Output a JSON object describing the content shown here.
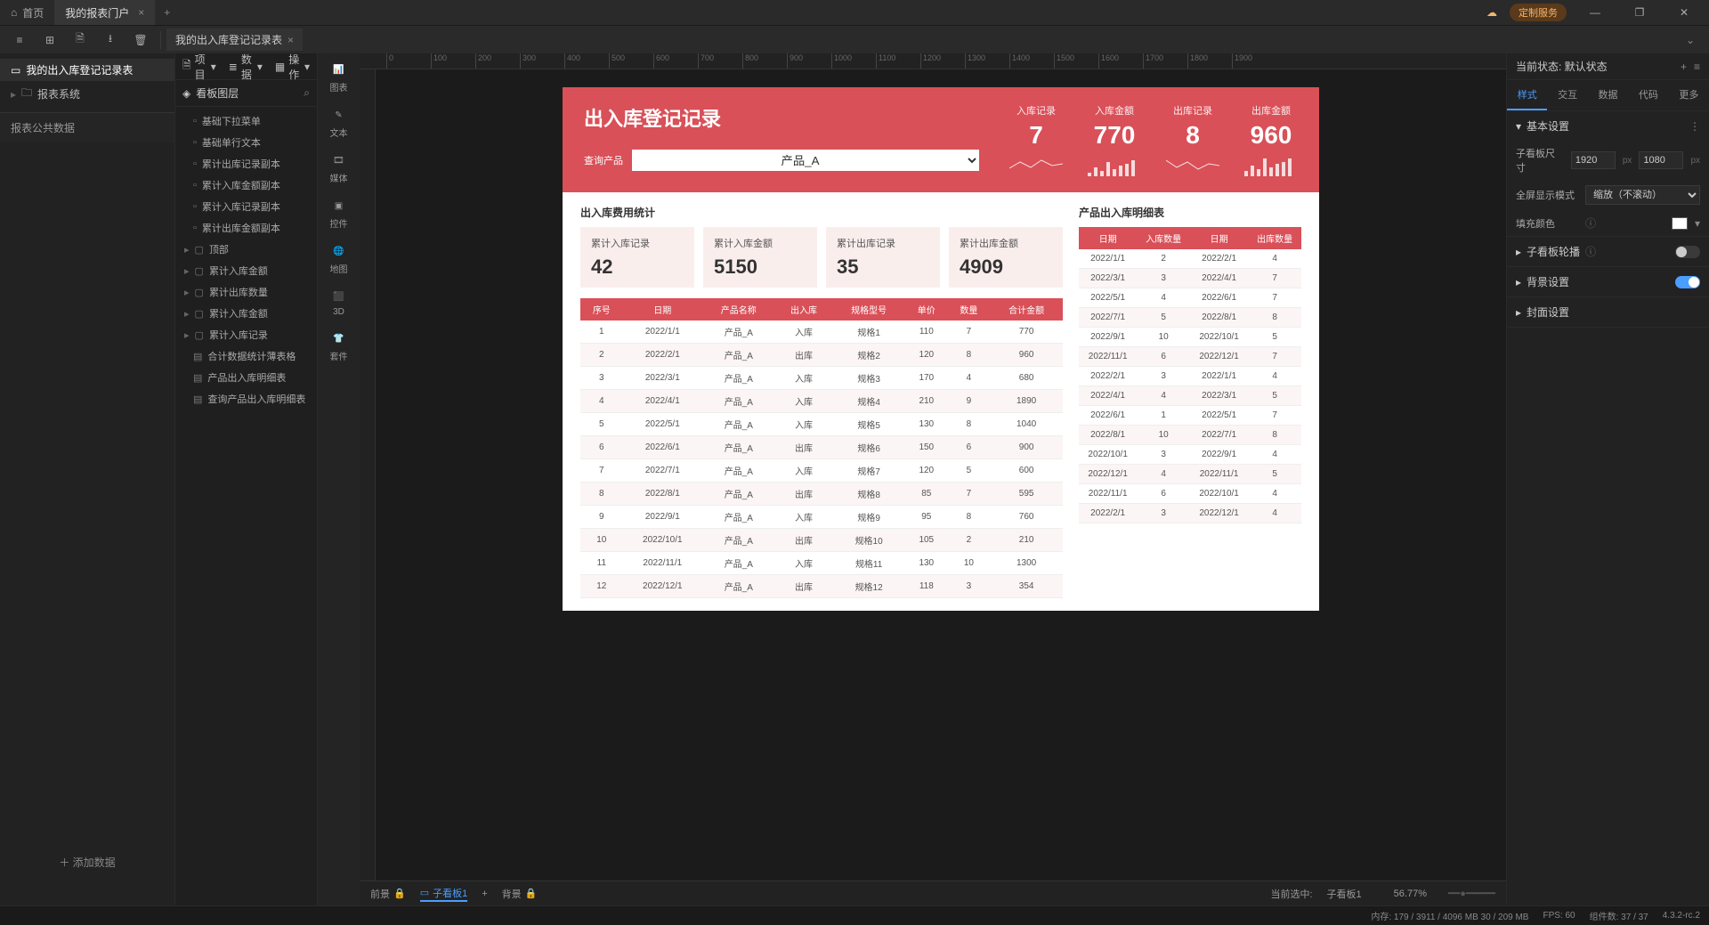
{
  "titlebar": {
    "home": "首页",
    "tab_active": "我的报表门户",
    "custom_service": "定制服务"
  },
  "toolbar": {
    "subtab": "我的出入库登记记录表"
  },
  "left_tree": {
    "item1": "我的出入库登记记录表",
    "item2": "报表系统"
  },
  "left_section": "报表公共数据",
  "left_add": "添加数据",
  "mid_toolbar": {
    "project": "项目",
    "data": "数据",
    "ops": "操作"
  },
  "mid_layerhead": "看板图层",
  "layers": [
    "基础下拉菜单",
    "基础单行文本",
    "累计出库记录副本",
    "累计入库金额副本",
    "累计入库记录副本",
    "累计出库金额副本"
  ],
  "layer_groups": [
    "顶部",
    "累计入库金额",
    "累计出库数量",
    "累计入库金额",
    "累计入库记录"
  ],
  "layers2": [
    "合计数据统计薄表格",
    "产品出入库明细表",
    "查询产品出入库明细表"
  ],
  "palette": {
    "chart": "图表",
    "text": "文本",
    "media": "媒体",
    "ctrl": "控件",
    "map": "地图",
    "d3": "3D",
    "suite": "套件"
  },
  "dashboard": {
    "title": "出入库登记记录",
    "query_label": "查询产品",
    "query_value": "产品_A",
    "kpis": [
      {
        "label": "入库记录",
        "value": "7"
      },
      {
        "label": "入库金额",
        "value": "770"
      },
      {
        "label": "出库记录",
        "value": "8"
      },
      {
        "label": "出库金额",
        "value": "960"
      }
    ],
    "stat_title": "出入库费用统计",
    "detail_title": "产品出入库明细表",
    "stats": [
      {
        "label": "累计入库记录",
        "value": "42"
      },
      {
        "label": "累计入库金额",
        "value": "5150"
      },
      {
        "label": "累计出库记录",
        "value": "35"
      },
      {
        "label": "累计出库金额",
        "value": "4909"
      }
    ],
    "main_headers": [
      "序号",
      "日期",
      "产品名称",
      "出入库",
      "规格型号",
      "单价",
      "数量",
      "合计金额"
    ],
    "main_rows": [
      [
        "1",
        "2022/1/1",
        "产品_A",
        "入库",
        "规格1",
        "110",
        "7",
        "770"
      ],
      [
        "2",
        "2022/2/1",
        "产品_A",
        "出库",
        "规格2",
        "120",
        "8",
        "960"
      ],
      [
        "3",
        "2022/3/1",
        "产品_A",
        "入库",
        "规格3",
        "170",
        "4",
        "680"
      ],
      [
        "4",
        "2022/4/1",
        "产品_A",
        "入库",
        "规格4",
        "210",
        "9",
        "1890"
      ],
      [
        "5",
        "2022/5/1",
        "产品_A",
        "入库",
        "规格5",
        "130",
        "8",
        "1040"
      ],
      [
        "6",
        "2022/6/1",
        "产品_A",
        "出库",
        "规格6",
        "150",
        "6",
        "900"
      ],
      [
        "7",
        "2022/7/1",
        "产品_A",
        "入库",
        "规格7",
        "120",
        "5",
        "600"
      ],
      [
        "8",
        "2022/8/1",
        "产品_A",
        "出库",
        "规格8",
        "85",
        "7",
        "595"
      ],
      [
        "9",
        "2022/9/1",
        "产品_A",
        "入库",
        "规格9",
        "95",
        "8",
        "760"
      ],
      [
        "10",
        "2022/10/1",
        "产品_A",
        "出库",
        "规格10",
        "105",
        "2",
        "210"
      ],
      [
        "11",
        "2022/11/1",
        "产品_A",
        "入库",
        "规格11",
        "130",
        "10",
        "1300"
      ],
      [
        "12",
        "2022/12/1",
        "产品_A",
        "出库",
        "规格12",
        "118",
        "3",
        "354"
      ]
    ],
    "detail_headers": [
      "日期",
      "入库数量",
      "日期",
      "出库数量"
    ],
    "detail_rows": [
      [
        "2022/1/1",
        "2",
        "2022/2/1",
        "4"
      ],
      [
        "2022/3/1",
        "3",
        "2022/4/1",
        "7"
      ],
      [
        "2022/5/1",
        "4",
        "2022/6/1",
        "7"
      ],
      [
        "2022/7/1",
        "5",
        "2022/8/1",
        "8"
      ],
      [
        "2022/9/1",
        "10",
        "2022/10/1",
        "5"
      ],
      [
        "2022/11/1",
        "6",
        "2022/12/1",
        "7"
      ],
      [
        "2022/2/1",
        "3",
        "2022/1/1",
        "4"
      ],
      [
        "2022/4/1",
        "4",
        "2022/3/1",
        "5"
      ],
      [
        "2022/6/1",
        "1",
        "2022/5/1",
        "7"
      ],
      [
        "2022/8/1",
        "10",
        "2022/7/1",
        "8"
      ],
      [
        "2022/10/1",
        "3",
        "2022/9/1",
        "4"
      ],
      [
        "2022/12/1",
        "4",
        "2022/11/1",
        "5"
      ],
      [
        "2022/11/1",
        "6",
        "2022/10/1",
        "4"
      ],
      [
        "2022/2/1",
        "3",
        "2022/12/1",
        "4"
      ]
    ]
  },
  "chart_data": {
    "sparklines": [
      {
        "label": "入库记录",
        "type": "line",
        "values": [
          5,
          7,
          4,
          8,
          6,
          7
        ]
      },
      {
        "label": "入库金额",
        "type": "bar",
        "values": [
          300,
          600,
          400,
          770,
          500,
          650,
          720,
          770
        ]
      },
      {
        "label": "出库记录",
        "type": "line",
        "values": [
          9,
          6,
          8,
          5,
          7,
          8
        ]
      },
      {
        "label": "出库金额",
        "type": "bar",
        "values": [
          400,
          700,
          500,
          960,
          600,
          800,
          850,
          960
        ]
      }
    ]
  },
  "canvas_footer": {
    "foreground": "前景",
    "subboard": "子看板1",
    "background": "背景",
    "zoom": "56.77%",
    "selected_prefix": "当前选中:",
    "selected": "子看板1"
  },
  "rightpanel": {
    "state_label": "当前状态: 默认状态",
    "tabs": [
      "样式",
      "交互",
      "数据",
      "代码",
      "更多"
    ],
    "basicset": "基本设置",
    "size_label": "子看板尺寸",
    "size_w": "1920",
    "size_h": "1080",
    "unit": "px",
    "fs_label": "全屏显示模式",
    "fs_value": "缩放（不滚动）",
    "fill_label": "填充颜色",
    "carousel": "子看板轮播",
    "bg": "背景设置",
    "cover": "封面设置"
  },
  "statusbar": {
    "mem": "内存:  179 / 3911 / 4096 MB  30 / 209 MB",
    "comp": "组件数: 37 / 37",
    "fps": "FPS:   60",
    "ver": "4.3.2-rc.2"
  },
  "ruler_ticks": [
    "0",
    "100",
    "200",
    "300",
    "400",
    "500",
    "600",
    "700",
    "800",
    "900",
    "1000",
    "1100",
    "1200",
    "1300",
    "1400",
    "1500",
    "1600",
    "1700",
    "1800",
    "1900"
  ]
}
